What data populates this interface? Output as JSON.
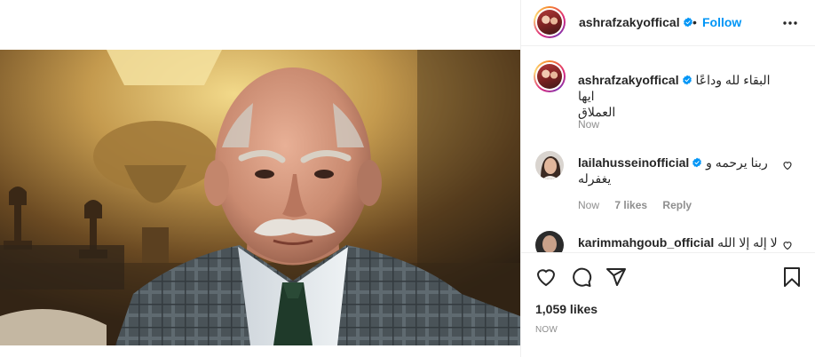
{
  "post": {
    "author": "ashrafzakyoffical",
    "separator": "•",
    "follow_label": "Follow",
    "caption_author": "ashrafzakyoffical",
    "caption_line1": "البقاء لله وداعًا ايها",
    "caption_line2": "العملاق",
    "caption_time": "Now"
  },
  "comments": [
    {
      "author": "lailahusseinofficial",
      "text_line1": "ربنا يرحمه و",
      "text_line2": "يغفرله",
      "time": "Now",
      "likes": "7 likes",
      "reply": "Reply"
    },
    {
      "author": "karimmahgoub_official",
      "text_line1": "لا إله إلا الله"
    }
  ],
  "footer": {
    "likes_count": "1,059 likes",
    "timestamp": "NOW"
  },
  "icons": {
    "verified": "verified-badge-icon",
    "more": "more-options-icon",
    "like": "heart-icon",
    "comment": "comment-icon",
    "share": "share-icon",
    "save": "bookmark-icon"
  },
  "colors": {
    "accent": "#0095f6",
    "text": "#262626",
    "muted": "#8e8e8e",
    "border": "#efefef"
  }
}
